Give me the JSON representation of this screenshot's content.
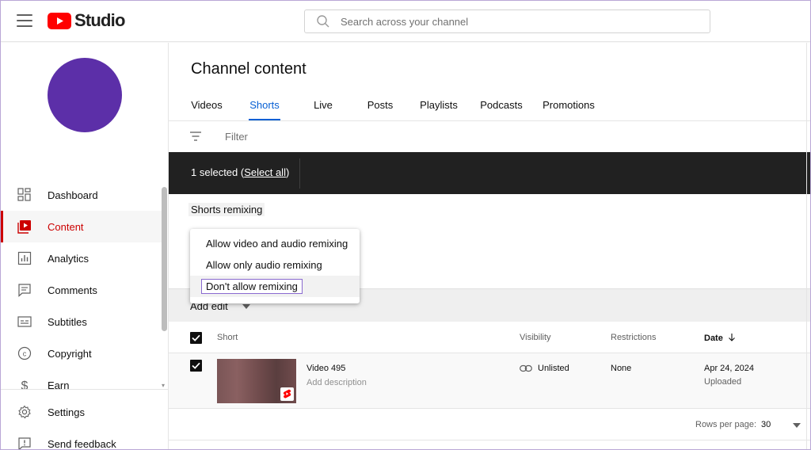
{
  "header": {
    "logo_text": "Studio",
    "search_placeholder": "Search across your channel"
  },
  "sidebar": {
    "items": [
      {
        "label": "Dashboard",
        "icon": "dashboard-icon"
      },
      {
        "label": "Content",
        "icon": "content-icon",
        "active": true
      },
      {
        "label": "Analytics",
        "icon": "analytics-icon"
      },
      {
        "label": "Comments",
        "icon": "comments-icon"
      },
      {
        "label": "Subtitles",
        "icon": "subtitles-icon"
      },
      {
        "label": "Copyright",
        "icon": "copyright-icon"
      },
      {
        "label": "Earn",
        "icon": "earn-icon"
      }
    ],
    "bottom_items": [
      {
        "label": "Settings",
        "icon": "gear-icon"
      },
      {
        "label": "Send feedback",
        "icon": "feedback-icon"
      }
    ]
  },
  "main": {
    "title": "Channel content",
    "tabs": [
      {
        "label": "Videos"
      },
      {
        "label": "Shorts",
        "active": true
      },
      {
        "label": "Live"
      },
      {
        "label": "Posts"
      },
      {
        "label": "Playlists"
      },
      {
        "label": "Podcasts"
      },
      {
        "label": "Promotions"
      }
    ],
    "filter_label": "Filter",
    "selection": {
      "count_text": "1 selected (",
      "select_all": "Select all",
      "close_paren": ")"
    },
    "remix_label": "Shorts remixing",
    "dropdown_options": [
      "Allow video and audio remixing",
      "Allow only audio remixing",
      "Don't allow remixing"
    ],
    "dropdown_highlighted_index": 2,
    "add_edit_label": "Add edit",
    "table": {
      "columns": {
        "short": "Short",
        "visibility": "Visibility",
        "restrictions": "Restrictions",
        "date": "Date"
      },
      "rows": [
        {
          "title": "Video 495",
          "description": "Add description",
          "visibility": "Unlisted",
          "restrictions": "None",
          "date": "Apr 24, 2024",
          "date_status": "Uploaded",
          "checked": true
        }
      ]
    },
    "pagination": {
      "rows_per_page_label": "Rows per page:",
      "rows_per_page_value": "30"
    }
  },
  "colors": {
    "brand_red": "#cc0000",
    "accent_blue": "#065fd4",
    "avatar": "#5c2fa8",
    "selection_bar": "#212121"
  }
}
